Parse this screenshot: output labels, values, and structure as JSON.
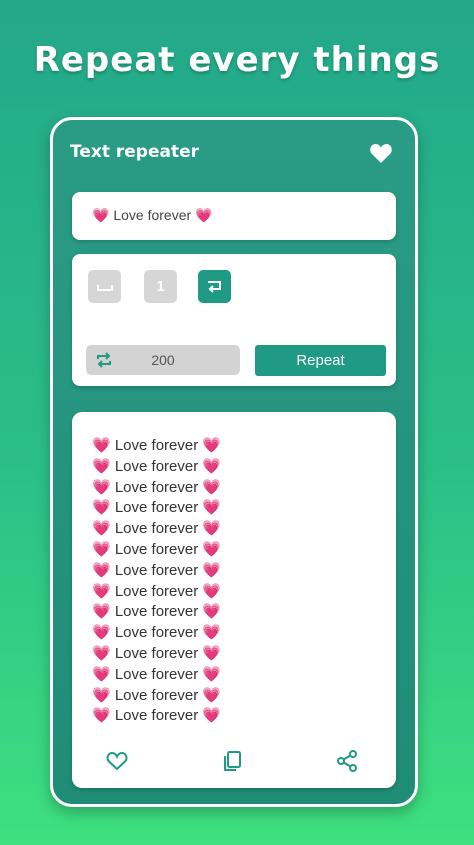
{
  "promo": {
    "headline": "Repeat every things"
  },
  "app": {
    "title": "Text repeater",
    "favorite_icon": "heart-icon"
  },
  "input": {
    "value": "💗 Love forever 💗"
  },
  "options": {
    "items": [
      {
        "name": "space",
        "icon": "space-bar-icon",
        "active": false
      },
      {
        "name": "number",
        "icon": "number-one-icon",
        "label": "1",
        "active": false
      },
      {
        "name": "new-line",
        "icon": "line-wrap-icon",
        "active": true
      }
    ],
    "count": {
      "icon": "repeat-icon",
      "value": "200"
    },
    "repeat_label": "Repeat"
  },
  "output": {
    "lines": [
      "💗 Love forever 💗",
      "💗 Love forever 💗",
      "💗 Love forever 💗",
      "💗 Love forever 💗",
      "💗 Love forever 💗",
      "💗 Love forever 💗",
      "💗 Love forever 💗",
      "💗 Love forever 💗",
      "💗 Love forever 💗",
      "💗 Love forever 💗",
      "💗 Love forever 💗",
      "💗 Love forever 💗",
      "💗 Love forever 💗",
      "💗 Love forever 💗"
    ]
  },
  "actions": [
    "heart-outline-icon",
    "copy-icon",
    "share-icon"
  ],
  "colors": {
    "accent": "#1f9a84",
    "background_top": "#23a88a",
    "background_bottom": "#3ee07f",
    "inactive_option": "#d6d6d6"
  }
}
